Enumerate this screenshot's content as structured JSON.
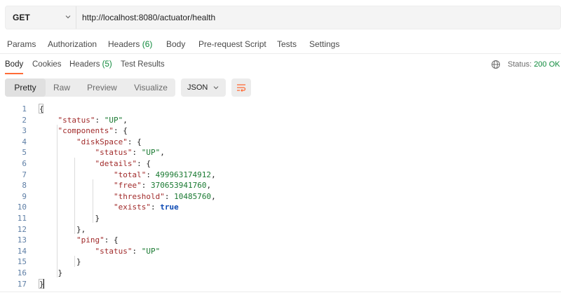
{
  "request": {
    "method": "GET",
    "url": "http://localhost:8080/actuator/health"
  },
  "request_tabs": [
    {
      "label": "Params"
    },
    {
      "label": "Authorization"
    },
    {
      "label": "Headers",
      "count": "(6)"
    },
    {
      "label": "Body"
    },
    {
      "label": "Pre-request Script"
    },
    {
      "label": "Tests"
    },
    {
      "label": "Settings"
    }
  ],
  "response_tabs": [
    {
      "label": "Body",
      "active": true
    },
    {
      "label": "Cookies"
    },
    {
      "label": "Headers",
      "count": "(5)"
    },
    {
      "label": "Test Results"
    }
  ],
  "response_status": {
    "label": "Status:",
    "value": "200 OK",
    "icon": "globe-icon"
  },
  "view_modes": [
    {
      "label": "Pretty",
      "active": true
    },
    {
      "label": "Raw"
    },
    {
      "label": "Preview"
    },
    {
      "label": "Visualize"
    }
  ],
  "format": {
    "selected": "JSON"
  },
  "wrap_icon": "wrap-lines-icon",
  "code_lines": [
    {
      "n": "1",
      "parts": [
        [
          "p",
          "{"
        ]
      ]
    },
    {
      "n": "2",
      "parts": [
        [
          "p",
          "    "
        ],
        [
          "k",
          "\"status\""
        ],
        [
          "p",
          ": "
        ],
        [
          "s",
          "\"UP\""
        ],
        [
          "p",
          ","
        ]
      ]
    },
    {
      "n": "3",
      "parts": [
        [
          "p",
          "    "
        ],
        [
          "k",
          "\"components\""
        ],
        [
          "p",
          ": {"
        ]
      ]
    },
    {
      "n": "4",
      "parts": [
        [
          "p",
          "        "
        ],
        [
          "k",
          "\"diskSpace\""
        ],
        [
          "p",
          ": {"
        ]
      ]
    },
    {
      "n": "5",
      "parts": [
        [
          "p",
          "            "
        ],
        [
          "k",
          "\"status\""
        ],
        [
          "p",
          ": "
        ],
        [
          "s",
          "\"UP\""
        ],
        [
          "p",
          ","
        ]
      ]
    },
    {
      "n": "6",
      "parts": [
        [
          "p",
          "            "
        ],
        [
          "k",
          "\"details\""
        ],
        [
          "p",
          ": {"
        ]
      ]
    },
    {
      "n": "7",
      "parts": [
        [
          "p",
          "                "
        ],
        [
          "k",
          "\"total\""
        ],
        [
          "p",
          ": "
        ],
        [
          "n",
          "499963174912"
        ],
        [
          "p",
          ","
        ]
      ]
    },
    {
      "n": "8",
      "parts": [
        [
          "p",
          "                "
        ],
        [
          "k",
          "\"free\""
        ],
        [
          "p",
          ": "
        ],
        [
          "n",
          "370653941760"
        ],
        [
          "p",
          ","
        ]
      ]
    },
    {
      "n": "9",
      "parts": [
        [
          "p",
          "                "
        ],
        [
          "k",
          "\"threshold\""
        ],
        [
          "p",
          ": "
        ],
        [
          "n",
          "10485760"
        ],
        [
          "p",
          ","
        ]
      ]
    },
    {
      "n": "10",
      "parts": [
        [
          "p",
          "                "
        ],
        [
          "k",
          "\"exists\""
        ],
        [
          "p",
          ": "
        ],
        [
          "b",
          "true"
        ]
      ]
    },
    {
      "n": "11",
      "parts": [
        [
          "p",
          "            }"
        ]
      ]
    },
    {
      "n": "12",
      "parts": [
        [
          "p",
          "        },"
        ]
      ]
    },
    {
      "n": "13",
      "parts": [
        [
          "p",
          "        "
        ],
        [
          "k",
          "\"ping\""
        ],
        [
          "p",
          ": {"
        ]
      ]
    },
    {
      "n": "14",
      "parts": [
        [
          "p",
          "            "
        ],
        [
          "k",
          "\"status\""
        ],
        [
          "p",
          ": "
        ],
        [
          "s",
          "\"UP\""
        ]
      ]
    },
    {
      "n": "15",
      "parts": [
        [
          "p",
          "        }"
        ]
      ]
    },
    {
      "n": "16",
      "parts": [
        [
          "p",
          "    }"
        ]
      ]
    },
    {
      "n": "17",
      "parts": [
        [
          "p",
          "}"
        ]
      ]
    }
  ],
  "colors": {
    "accent": "#ff6c37",
    "success": "#0f8a3c",
    "json_key": "#a12b2b",
    "json_string": "#1a7a32",
    "json_bool": "#0e4bb5"
  }
}
